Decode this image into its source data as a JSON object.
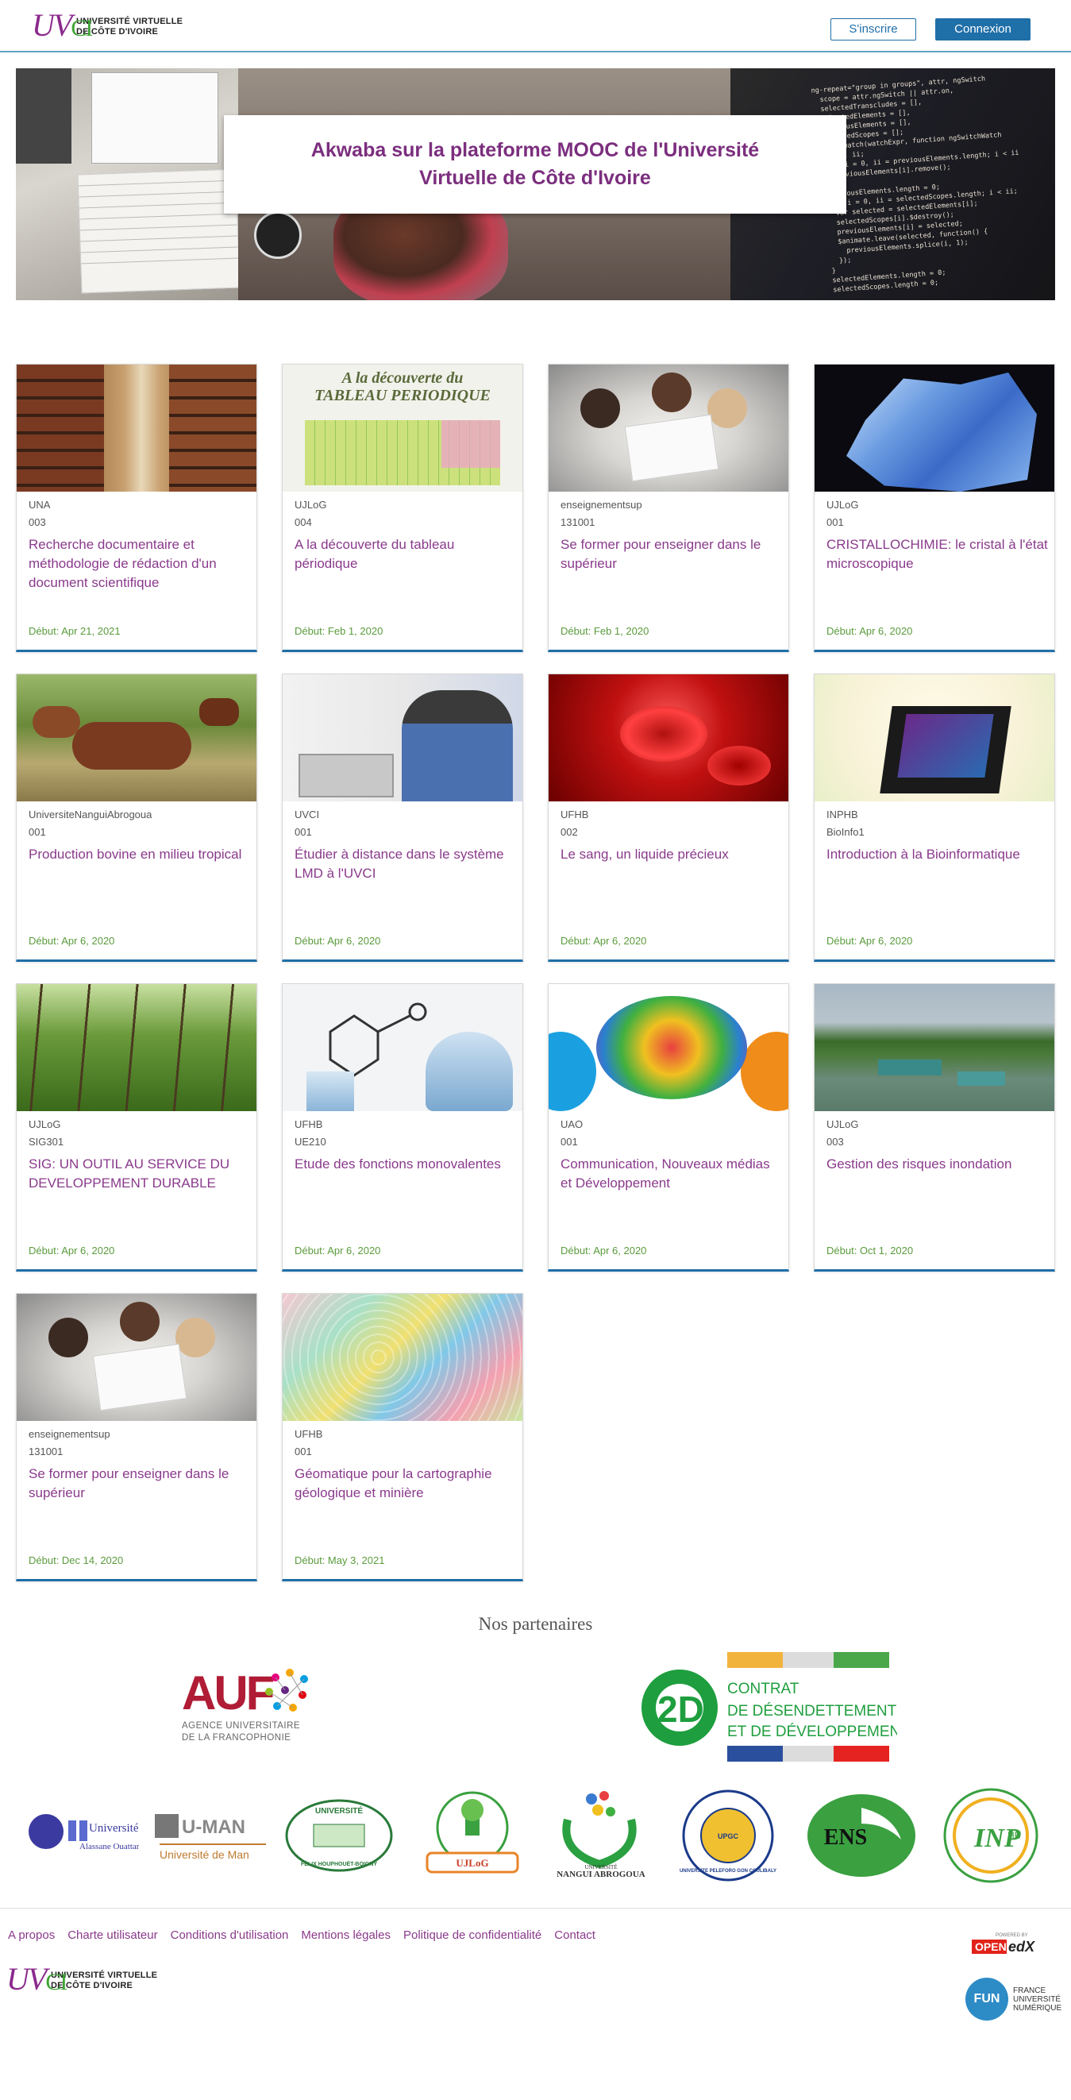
{
  "header": {
    "logo_mark": "UV",
    "logo_mark_ci": "CI",
    "logo_line1": "UNIVERSITÉ VIRTUELLE",
    "logo_line2": "DE CÔTE D'IVOIRE",
    "signup_label": "S'inscrire",
    "login_label": "Connexion"
  },
  "hero": {
    "title_line1": "Akwaba sur la plateforme MOOC de l'Université",
    "title_line2": "Virtuelle de Côte d'Ivoire"
  },
  "courses": [
    {
      "org": "UNA",
      "code": "003",
      "title": "Recherche documentaire et méthodologie de rédaction d'un document scientifique",
      "date": "Début: Apr 21, 2021",
      "thumb": "library"
    },
    {
      "org": "UJLoG",
      "code": "004",
      "title": "A la découverte du tableau périodique",
      "date": "Début: Feb 1, 2020",
      "thumb": "periodic-table"
    },
    {
      "org": "enseignementsup",
      "code": "131001",
      "title": "Se former pour enseigner dans le supérieur",
      "date": "Début: Feb 1, 2020",
      "thumb": "students"
    },
    {
      "org": "UJLoG",
      "code": "001",
      "title": "CRISTALLOCHIMIE: le cristal à l'état microscopique",
      "date": "Début: Apr 6, 2020",
      "thumb": "crystal"
    },
    {
      "org": "UniversiteNanguiAbrogoua",
      "code": "001",
      "title": "Production bovine en milieu tropical",
      "date": "Début: Apr 6, 2020",
      "thumb": "cattle"
    },
    {
      "org": "UVCI",
      "code": "001",
      "title": "Étudier à distance dans le système LMD à l'UVCI",
      "date": "Début: Apr 6, 2020",
      "thumb": "laptop-student"
    },
    {
      "org": "UFHB",
      "code": "002",
      "title": "Le sang, un liquide précieux",
      "date": "Début: Apr 6, 2020",
      "thumb": "blood"
    },
    {
      "org": "INPHB",
      "code": "BioInfo1",
      "title": "Introduction à la Bioinformatique",
      "date": "Début: Apr 6, 2020",
      "thumb": "bioinfo"
    },
    {
      "org": "UJLoG",
      "code": "SIG301",
      "title": "SIG: UN OUTIL AU SERVICE DU DEVELOPPEMENT DURABLE",
      "date": "Début: Apr 6, 2020",
      "thumb": "forest"
    },
    {
      "org": "UFHB",
      "code": "UE210",
      "title": "Etude des fonctions monovalentes",
      "date": "Début: Apr 6, 2020",
      "thumb": "chemistry"
    },
    {
      "org": "UAO",
      "code": "001",
      "title": "Communication, Nouveaux médias et Développement",
      "date": "Début: Apr 6, 2020",
      "thumb": "media"
    },
    {
      "org": "UJLoG",
      "code": "003",
      "title": "Gestion des risques inondation",
      "date": "Début: Oct 1, 2020",
      "thumb": "flood"
    },
    {
      "org": "enseignementsup",
      "code": "131001",
      "title": "Se former pour enseigner dans le supérieur",
      "date": "Début: Dec 14, 2020",
      "thumb": "students"
    },
    {
      "org": "UFHB",
      "code": "001",
      "title": "Géomatique pour la cartographie géologique et minière",
      "date": "Début: May 3, 2021",
      "thumb": "geomap"
    }
  ],
  "thumb_text": {
    "periodic_line1": "A la découverte du",
    "periodic_line2": "TABLEAU PERIODIQUE"
  },
  "partners": {
    "title": "Nos partenaires",
    "auf_mark": "AUF",
    "auf_line1": "AGENCE UNIVERSITAIRE",
    "auf_line2": "DE LA FRANCOPHONIE",
    "c2d_mark": "2D",
    "c2d_line1": "CONTRAT",
    "c2d_line2": "DE DÉSENDETTEMENT",
    "c2d_line3": "ET DE DÉVELOPPEMENT",
    "logos": [
      {
        "name": "universite-alassane-ouattara",
        "line1": "Université",
        "line2": "Alassane Ouattara"
      },
      {
        "name": "universite-de-man",
        "line1": "U-MAN",
        "line2": "Université de Man"
      },
      {
        "name": "universite-felix-houphouet-boigny",
        "line1": "UNIVERSITÉ",
        "line2": "FÉLIX HOUPHOUËT-BOIGNY"
      },
      {
        "name": "ujlog",
        "line1": "UJLoG",
        "line2": ""
      },
      {
        "name": "universite-nangui-abrogoua",
        "line1": "UNIVERSITÉ",
        "line2": "NANGUI ABROGOUA"
      },
      {
        "name": "universite-peleforo-gon-coulibaly",
        "line1": "UNIVERSITE PELEFORO GON COULIBALY",
        "line2": "UPGC"
      },
      {
        "name": "ens",
        "line1": "ENS",
        "line2": ""
      },
      {
        "name": "inphb",
        "line1": "INP",
        "line2": "HB"
      }
    ]
  },
  "footer": {
    "links": [
      "A propos",
      "Charte utilisateur",
      "Conditions d'utilisation",
      "Mentions légales",
      "Politique de confidentialité",
      "Contact"
    ],
    "edx_small": "POWERED BY",
    "edx_open": "OPEN",
    "edx_edx": "edX",
    "fun_circle": "FUN",
    "fun_line1": "FRANCE",
    "fun_line2": "UNIVERSITÉ",
    "fun_line3": "NUMÉRIQUE"
  },
  "colors": {
    "brand_purple": "#8a3a8c",
    "brand_blue": "#1f6fa8",
    "date_green": "#5a9b3c"
  }
}
